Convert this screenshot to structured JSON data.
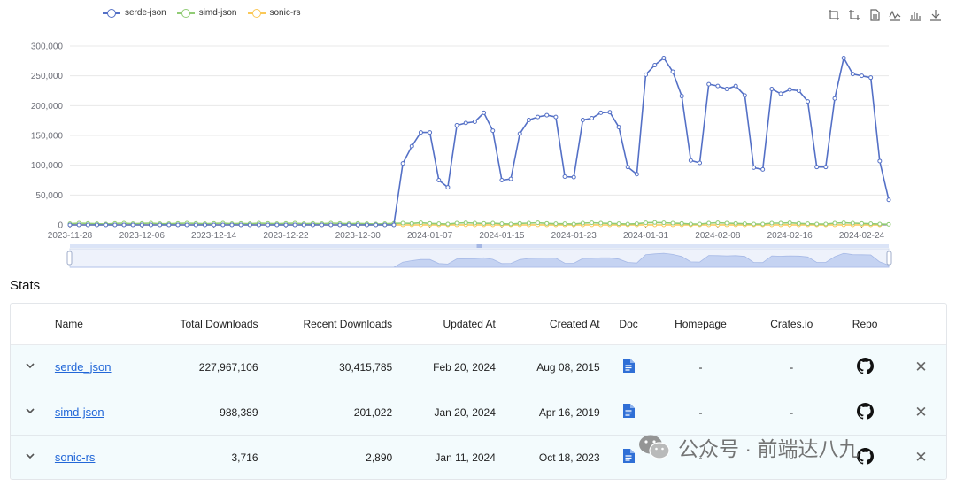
{
  "legend": [
    {
      "name": "serde-json",
      "color": "#5470c6"
    },
    {
      "name": "simd-json",
      "color": "#91cc75"
    },
    {
      "name": "sonic-rs",
      "color": "#fac858"
    }
  ],
  "toolbox": [
    "zoom-icon",
    "zoom-reset-icon",
    "data-view-icon",
    "line-chart-icon",
    "bar-chart-icon",
    "download-icon"
  ],
  "chart_data": {
    "type": "line",
    "title": "",
    "xlabel": "",
    "ylabel": "",
    "ylim": [
      0,
      300000
    ],
    "yticks": [
      0,
      50000,
      100000,
      150000,
      200000,
      250000,
      300000
    ],
    "ytick_labels": [
      "0",
      "50,000",
      "100,000",
      "150,000",
      "200,000",
      "250,000",
      "300,000"
    ],
    "xtick_labels": [
      "2023-11-28",
      "2023-12-06",
      "2023-12-14",
      "2023-12-22",
      "2023-12-30",
      "2024-01-07",
      "2024-01-15",
      "2024-01-23",
      "2024-01-31",
      "2024-02-08",
      "2024-02-16",
      "2024-02-24"
    ],
    "x_start": "2023-11-28",
    "x_end": "2024-02-24",
    "grid": true,
    "legend_position": "top-left",
    "series": [
      {
        "name": "serde-json",
        "color": "#5470c6",
        "values": [
          0,
          0,
          0,
          0,
          0,
          0,
          0,
          0,
          0,
          0,
          0,
          0,
          0,
          0,
          0,
          0,
          0,
          0,
          0,
          0,
          0,
          0,
          0,
          0,
          0,
          0,
          0,
          0,
          0,
          0,
          0,
          0,
          0,
          0,
          0,
          0,
          0,
          103000,
          132000,
          155000,
          155000,
          75000,
          63000,
          167000,
          171000,
          173000,
          188000,
          158000,
          75000,
          77000,
          153000,
          176000,
          181000,
          184000,
          181000,
          81000,
          80000,
          176000,
          179000,
          188000,
          189000,
          164000,
          97000,
          85000,
          252000,
          268000,
          280000,
          257000,
          216000,
          108000,
          104000,
          236000,
          233000,
          228000,
          233000,
          217000,
          96000,
          93000,
          228000,
          220000,
          227000,
          225000,
          207000,
          97000,
          97000,
          212000,
          280000,
          253000,
          250000,
          247000,
          107000,
          42000
        ]
      },
      {
        "name": "simd-json",
        "color": "#91cc75",
        "values": [
          2000,
          3000,
          2500,
          2000,
          1500,
          2500,
          3000,
          2000,
          2500,
          3000,
          2000,
          2000,
          2500,
          3000,
          2500,
          2000,
          2500,
          3000,
          2000,
          2500,
          2000,
          3000,
          2500,
          2000,
          2500,
          3000,
          2000,
          2500,
          2000,
          3000,
          2500,
          2000,
          2500,
          2000,
          1500,
          2000,
          2500,
          3000,
          2500,
          3500,
          2500,
          2000,
          1500,
          3000,
          3500,
          3000,
          2500,
          3000,
          2000,
          1500,
          2500,
          3000,
          3500,
          2500,
          2000,
          2000,
          1500,
          3000,
          3500,
          3000,
          2500,
          2000,
          1500,
          2000,
          3500,
          4000,
          3500,
          3000,
          2500,
          1500,
          1500,
          3000,
          3500,
          3000,
          2500,
          2000,
          1500,
          1500,
          3000,
          3000,
          3500,
          2500,
          2000,
          1500,
          1500,
          3000,
          3500,
          3000,
          2500,
          2000,
          1500,
          1000
        ]
      },
      {
        "name": "sonic-rs",
        "color": "#fac858",
        "values": [
          100,
          100,
          50,
          50,
          100,
          50,
          100,
          50,
          50,
          100,
          50,
          50,
          100,
          50,
          50,
          100,
          50,
          50,
          100,
          50,
          50,
          100,
          50,
          50,
          100,
          50,
          50,
          100,
          50,
          50,
          100,
          50,
          50,
          100,
          50,
          50,
          100,
          100,
          50,
          50,
          100,
          50,
          50,
          100,
          50,
          50,
          100,
          50,
          50,
          100,
          50,
          50,
          100,
          50,
          50,
          100,
          50,
          50,
          100,
          50,
          50,
          100,
          50,
          50,
          100,
          50,
          50,
          100,
          50,
          50,
          100,
          50,
          50,
          100,
          50,
          50,
          100,
          50,
          50,
          100,
          50,
          50,
          100,
          50,
          50,
          100,
          50,
          50,
          100,
          50,
          50
        ]
      }
    ]
  },
  "stats": {
    "title": "Stats",
    "headers": {
      "name": "Name",
      "total": "Total Downloads",
      "recent": "Recent Downloads",
      "updated": "Updated At",
      "created": "Created At",
      "doc": "Doc",
      "homepage": "Homepage",
      "crates": "Crates.io",
      "repo": "Repo"
    },
    "rows": [
      {
        "name": "serde_json",
        "total": "227,967,106",
        "recent": "30,415,785",
        "updated": "Feb 20, 2024",
        "created": "Aug 08, 2015",
        "homepage": "-",
        "crates": "-"
      },
      {
        "name": "simd-json",
        "total": "988,389",
        "recent": "201,022",
        "updated": "Jan 20, 2024",
        "created": "Apr 16, 2019",
        "homepage": "-",
        "crates": "-"
      },
      {
        "name": "sonic-rs",
        "total": "3,716",
        "recent": "2,890",
        "updated": "Jan 11, 2024",
        "created": "Oct 18, 2023",
        "homepage": "-",
        "crates": "-"
      }
    ]
  },
  "watermark": {
    "text": "公众号 · 前端达八九"
  }
}
